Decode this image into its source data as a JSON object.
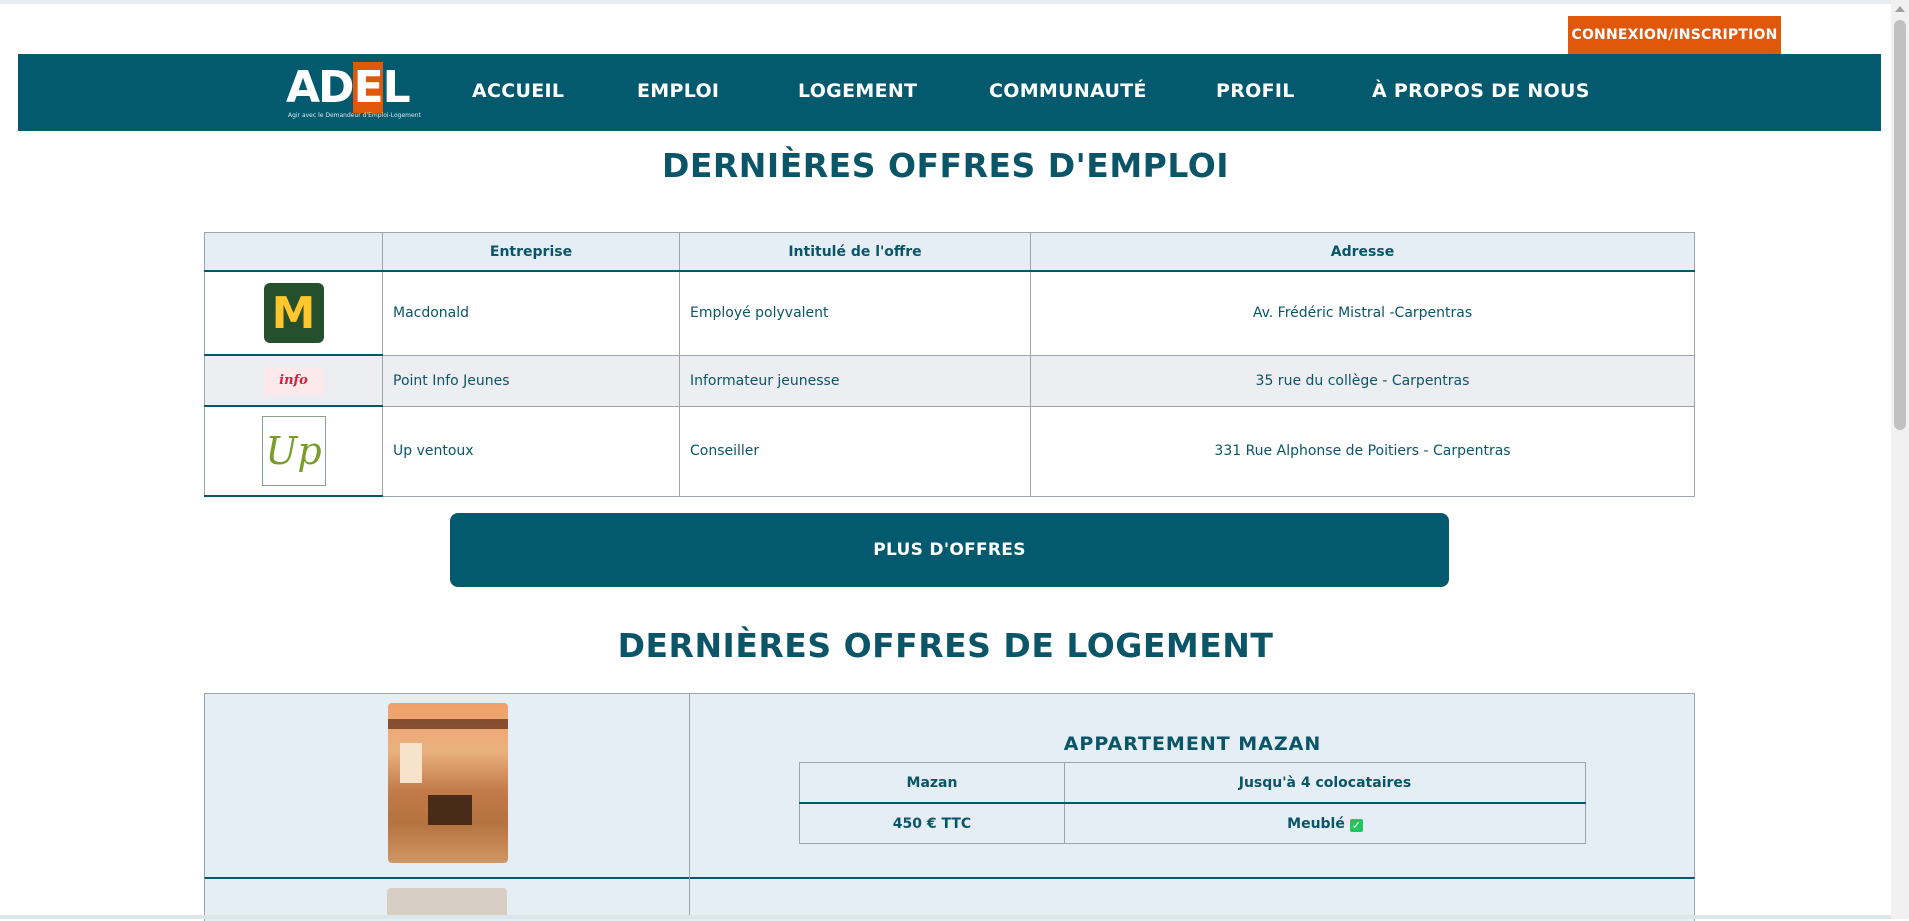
{
  "header": {
    "login_label": "CONNEXION/INSCRIPTION",
    "logo_text": "ADEL",
    "logo_tagline": "Agir avec le Demandeur d'Emploi-Logement",
    "nav": [
      "ACCUEIL",
      "EMPLOI",
      "LOGEMENT",
      "COMMUNAUTÉ",
      "PROFIL",
      "À PROPOS DE NOUS"
    ]
  },
  "jobs": {
    "title": "DERNIÈRES OFFRES D'EMPLOI",
    "columns": [
      "",
      "Entreprise",
      "Intitulé de l'offre",
      "Adresse"
    ],
    "rows": [
      {
        "logo": "mcdonalds-logo",
        "company": "Macdonald",
        "job": "Employé polyvalent",
        "address": "Av. Frédéric Mistral -Carpentras"
      },
      {
        "logo": "info-jeunes-logo",
        "company": "Point Info Jeunes",
        "job": "Informateur jeunesse",
        "address": "35 rue du collège - Carpentras"
      },
      {
        "logo": "up-ventoux-logo",
        "company": "Up ventoux",
        "job": "Conseiller",
        "address": "331 Rue Alphonse de Poitiers - Carpentras"
      }
    ],
    "more_label": "PLUS D'OFFRES"
  },
  "housing": {
    "title": "DERNIÈRES OFFRES DE LOGEMENT",
    "items": [
      {
        "name": "APPARTEMENT MAZAN",
        "city": "Mazan",
        "capacity": "Jusqu'à 4 colocataires",
        "price": "450 € TTC",
        "furnished": "Meublé"
      }
    ]
  },
  "colors": {
    "primary": "#035a6f",
    "accent": "#e0580c",
    "table_head": "#e4eef4"
  }
}
